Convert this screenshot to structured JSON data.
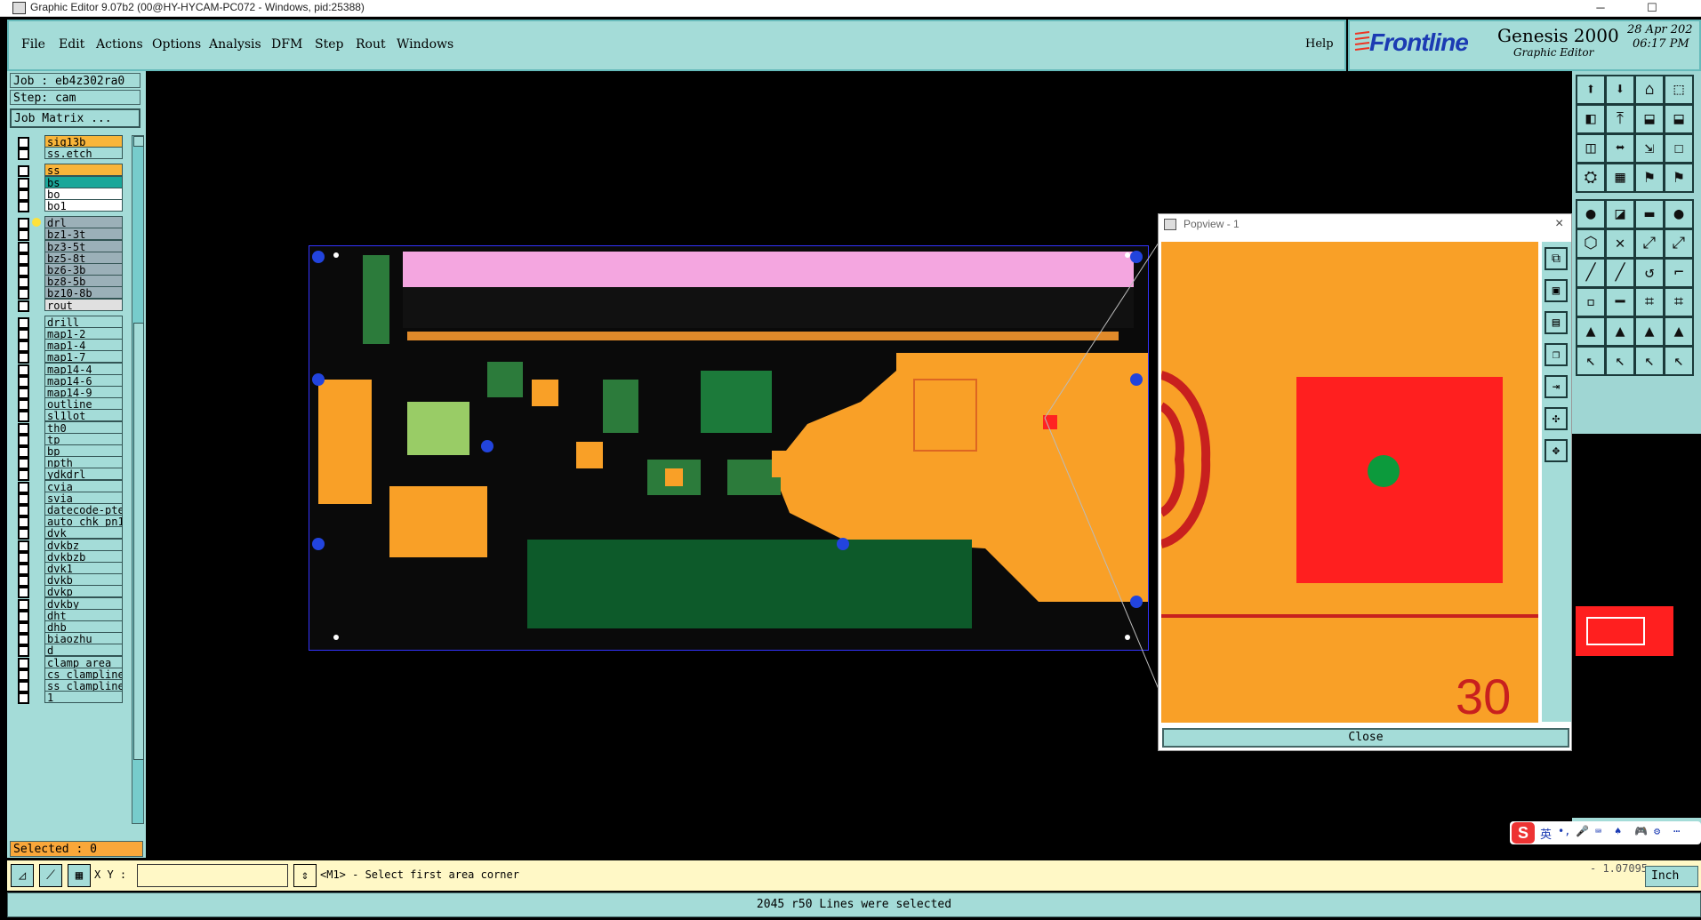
{
  "window": {
    "title": "Graphic Editor 9.07b2 (00@HY-HYCAM-PC072 - Windows, pid:25388)",
    "minimize": "─",
    "maximize": "☐"
  },
  "menu": {
    "items": [
      "File",
      "Edit",
      "Actions",
      "Options",
      "Analysis",
      "DFM",
      "Step",
      "Rout",
      "Windows"
    ],
    "help": "Help"
  },
  "brand": {
    "logo": "Frontline",
    "product": "Genesis 2000",
    "subtitle": "Graphic Editor",
    "date": "28 Apr 202",
    "time": "06:17 PM"
  },
  "job": {
    "job_label": "Job : eb4z302ra0",
    "step_label": "Step: cam",
    "matrix_button": "Job Matrix ..."
  },
  "layers": [
    {
      "name": "sig13b",
      "color": "#f9b53a"
    },
    {
      "name": "ss.etch",
      "color": "#a4dcd8"
    },
    {
      "name": "ss",
      "color": "#f9b53a"
    },
    {
      "name": "bs",
      "color": "#1aa79a"
    },
    {
      "name": "bo",
      "color": "#ffffff"
    },
    {
      "name": "bo1",
      "color": "#ffffff"
    },
    {
      "name": "drl",
      "color": "#9bb0b8"
    },
    {
      "name": "bz1-3t",
      "color": "#9bb0b8"
    },
    {
      "name": "bz3-5t",
      "color": "#9bb0b8"
    },
    {
      "name": "bz5-8t",
      "color": "#9bb0b8"
    },
    {
      "name": "bz6-3b",
      "color": "#9bb0b8"
    },
    {
      "name": "bz8-5b",
      "color": "#9bb0b8"
    },
    {
      "name": "bz10-8b",
      "color": "#9bb0b8"
    },
    {
      "name": "rout",
      "color": "#e0e0e0"
    },
    {
      "name": "drill",
      "color": "#a4dcd8"
    },
    {
      "name": "map1-2",
      "color": "#a4dcd8"
    },
    {
      "name": "map1-4",
      "color": "#a4dcd8"
    },
    {
      "name": "map1-7",
      "color": "#a4dcd8"
    },
    {
      "name": "map14-4",
      "color": "#a4dcd8"
    },
    {
      "name": "map14-6",
      "color": "#a4dcd8"
    },
    {
      "name": "map14-9",
      "color": "#a4dcd8"
    },
    {
      "name": "outline",
      "color": "#a4dcd8"
    },
    {
      "name": "sl1lot",
      "color": "#a4dcd8"
    },
    {
      "name": "th0",
      "color": "#a4dcd8"
    },
    {
      "name": "tp",
      "color": "#a4dcd8"
    },
    {
      "name": "bp",
      "color": "#a4dcd8"
    },
    {
      "name": "npth",
      "color": "#a4dcd8"
    },
    {
      "name": "ydkdrl",
      "color": "#a4dcd8"
    },
    {
      "name": "cvia",
      "color": "#a4dcd8"
    },
    {
      "name": "svia",
      "color": "#a4dcd8"
    },
    {
      "name": "datecode-pte",
      "color": "#a4dcd8"
    },
    {
      "name": "auto_chk_pn1",
      "color": "#a4dcd8"
    },
    {
      "name": "dvk",
      "color": "#a4dcd8"
    },
    {
      "name": "dvkbz",
      "color": "#a4dcd8"
    },
    {
      "name": "dvkbzb",
      "color": "#a4dcd8"
    },
    {
      "name": "dvk1",
      "color": "#a4dcd8"
    },
    {
      "name": "dvkb",
      "color": "#a4dcd8"
    },
    {
      "name": "dvkp",
      "color": "#a4dcd8"
    },
    {
      "name": "dvkby",
      "color": "#a4dcd8"
    },
    {
      "name": "dht",
      "color": "#a4dcd8"
    },
    {
      "name": "dhb",
      "color": "#a4dcd8"
    },
    {
      "name": "biaozhu",
      "color": "#a4dcd8"
    },
    {
      "name": "d",
      "color": "#a4dcd8"
    },
    {
      "name": "clamp_area",
      "color": "#a4dcd8"
    },
    {
      "name": "cs_clampline",
      "color": "#a4dcd8"
    },
    {
      "name": "ss_clampline",
      "color": "#a4dcd8"
    },
    {
      "name": "1",
      "color": "#a4dcd8"
    }
  ],
  "selected_label": "Selected : 0",
  "popview": {
    "title": "Popview - 1",
    "close_label": "Close",
    "number": "30",
    "close_x": "×"
  },
  "bottom": {
    "xy_label": "X Y :",
    "xy_value": "",
    "prompt": "<M1> - Select first area corner",
    "units": "Inch",
    "coord": "- 1.07095"
  },
  "status": "2045 r50 Lines were selected",
  "ime": {
    "label": "英",
    "icons": [
      "•,",
      "🎤",
      "⌨",
      "♠",
      "🎮",
      "⚙",
      "⋯"
    ]
  },
  "colors": {
    "panel": "#a4dcd8",
    "orange": "#f9a027",
    "red": "#ff1f1f",
    "green": "#0c9a3c",
    "accent": "#f9b53a"
  }
}
